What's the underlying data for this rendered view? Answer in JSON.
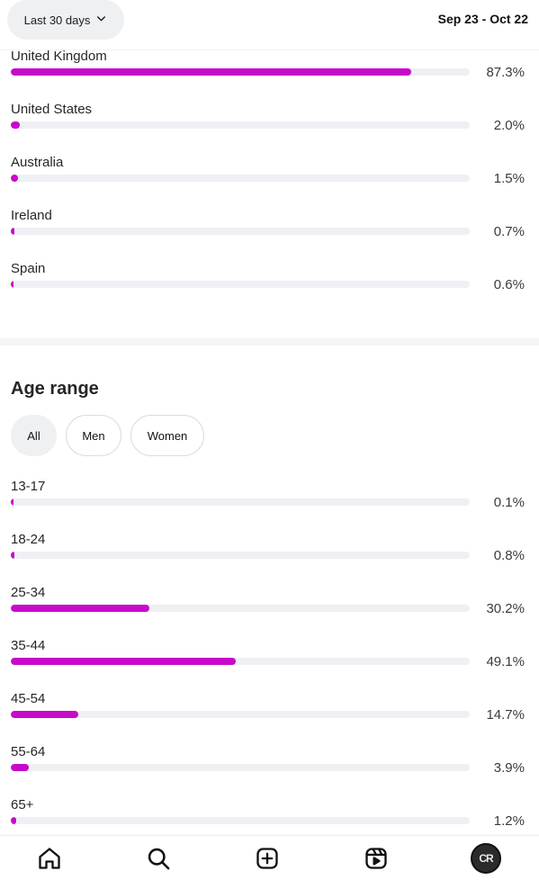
{
  "header": {
    "range_label": "Last 30 days",
    "date_range": "Sep 23 - Oct 22"
  },
  "locations": [
    {
      "label": "United Kingdom",
      "value": "87.3%",
      "fraction": 0.873
    },
    {
      "label": "United States",
      "value": "2.0%",
      "fraction": 0.02
    },
    {
      "label": "Australia",
      "value": "1.5%",
      "fraction": 0.015
    },
    {
      "label": "Ireland",
      "value": "0.7%",
      "fraction": 0.007
    },
    {
      "label": "Spain",
      "value": "0.6%",
      "fraction": 0.006
    }
  ],
  "age": {
    "title": "Age range",
    "filters": [
      "All",
      "Men",
      "Women"
    ],
    "active_filter": "All",
    "rows": [
      {
        "label": "13-17",
        "value": "0.1%",
        "fraction": 0.001
      },
      {
        "label": "18-24",
        "value": "0.8%",
        "fraction": 0.008
      },
      {
        "label": "25-34",
        "value": "30.2%",
        "fraction": 0.302
      },
      {
        "label": "35-44",
        "value": "49.1%",
        "fraction": 0.491
      },
      {
        "label": "45-54",
        "value": "14.7%",
        "fraction": 0.147
      },
      {
        "label": "55-64",
        "value": "3.9%",
        "fraction": 0.039
      },
      {
        "label": "65+",
        "value": "1.2%",
        "fraction": 0.012
      }
    ]
  },
  "colors": {
    "bar_fill": "#c70ac9",
    "bar_track": "#eef0f3"
  },
  "nav": {
    "avatar_text": "CR",
    "icons": [
      "home-icon",
      "search-icon",
      "create-icon",
      "reels-icon",
      "profile-avatar"
    ]
  }
}
